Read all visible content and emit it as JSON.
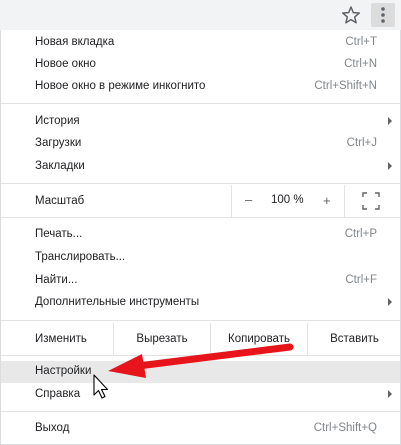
{
  "toolbar": {
    "bookmark_icon": "star-icon",
    "menu_icon": "three-dots-vertical-icon"
  },
  "menu": {
    "group1": [
      {
        "label": "Новая вкладка",
        "shortcut": "Ctrl+T"
      },
      {
        "label": "Новое окно",
        "shortcut": "Ctrl+N"
      },
      {
        "label": "Новое окно в режиме инкогнито",
        "shortcut": "Ctrl+Shift+N"
      }
    ],
    "group2": [
      {
        "label": "История",
        "has_submenu": true
      },
      {
        "label": "Загрузки",
        "shortcut": "Ctrl+J"
      },
      {
        "label": "Закладки",
        "has_submenu": true
      }
    ],
    "zoom": {
      "label": "Масштаб",
      "minus": "–",
      "value": "100 %",
      "plus": "+",
      "fullscreen_icon": "fullscreen-icon"
    },
    "group3": [
      {
        "label": "Печать...",
        "shortcut": "Ctrl+P"
      },
      {
        "label": "Транслировать..."
      },
      {
        "label": "Найти...",
        "shortcut": "Ctrl+F"
      },
      {
        "label": "Дополнительные инструменты",
        "has_submenu": true
      }
    ],
    "edit": {
      "label": "Изменить",
      "cut": "Вырезать",
      "copy": "Копировать",
      "paste": "Вставить"
    },
    "group4": [
      {
        "label": "Настройки",
        "highlighted": true
      },
      {
        "label": "Справка",
        "has_submenu": true
      }
    ],
    "group5": [
      {
        "label": "Выход",
        "shortcut": "Ctrl+Shift+Q"
      }
    ]
  },
  "annotation": {
    "arrow_color": "#e8141c",
    "arrow_icon": "red-arrow-annotation",
    "cursor_icon": "mouse-pointer-icon"
  }
}
